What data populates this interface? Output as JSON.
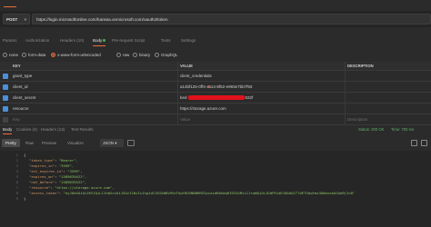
{
  "request": {
    "method": "POST",
    "url": "https://login.microsoftonline.com/hanssa.onmicrosoft.com/oauth2/token"
  },
  "request_tabs": [
    {
      "label": "Params"
    },
    {
      "label": "Authorization"
    },
    {
      "label": "Headers (10)"
    },
    {
      "label": "Body"
    },
    {
      "label": "Pre-request Script"
    },
    {
      "label": "Tests"
    },
    {
      "label": "Settings"
    }
  ],
  "body_types": [
    {
      "label": "none",
      "selected": false
    },
    {
      "label": "form-data",
      "selected": false
    },
    {
      "label": "x-www-form-urlencoded",
      "selected": true
    },
    {
      "label": "raw",
      "selected": false
    },
    {
      "label": "binary",
      "selected": false
    },
    {
      "label": "GraphQL",
      "selected": false
    }
  ],
  "params_table": {
    "headers": [
      "KEY",
      "VALUE",
      "DESCRIPTION"
    ],
    "rows": [
      {
        "key": "grant_type",
        "value": "client_credentials",
        "checked": true
      },
      {
        "key": "client_id",
        "value": "a14bf125-0ff4-4114-8f52-e993e7bb7f93",
        "checked": true
      },
      {
        "key": "client_secret",
        "value_prefix": "bed",
        "value_suffix": "832f",
        "checked": true
      },
      {
        "key": "resource",
        "value": "https://storage.azure.com",
        "checked": true
      },
      {
        "key": "Key",
        "value": "Value",
        "description": "Description",
        "checked": false
      }
    ]
  },
  "response_tabs": [
    {
      "label": "Body"
    },
    {
      "label": "Cookies (4)"
    },
    {
      "label": "Headers (13)"
    },
    {
      "label": "Test Results"
    }
  ],
  "response_status": {
    "code": "Status: 200 OK",
    "time": "Time: 700 ms"
  },
  "response_views": [
    {
      "label": "Pretty"
    },
    {
      "label": "Raw"
    },
    {
      "label": "Preview"
    },
    {
      "label": "Visualize"
    }
  ],
  "response_format": "JSON",
  "response_lines": [
    {
      "n": "1",
      "text": "{"
    },
    {
      "n": "2",
      "key": "\"token_type\"",
      "val": "\"Bearer\","
    },
    {
      "n": "3",
      "key": "\"expires_in\"",
      "val": "\"3599\","
    },
    {
      "n": "4",
      "key": "\"ext_expires_in\"",
      "val": "\"3599\","
    },
    {
      "n": "5",
      "key": "\"expires_on\"",
      "val": "\"1589639422\","
    },
    {
      "n": "6",
      "key": "\"not_before\"",
      "val": "\"1589635522\","
    },
    {
      "n": "7",
      "key": "\"resource\"",
      "val": "\"https://storage.azure.com\","
    },
    {
      "n": "8",
      "key": "\"access_token\"",
      "val": "\"eyJ0eXAiOiJKV1QiLCJhbGciOiJSUzI1NiIsIng1dCI6IkN0VHVoTUptRDVNN0RMZ2piazdRbGdqR3ZCb2MiLCJraWQiOiJDdFR1aE1KbUQ1TTdETGdqYms3UWxnakd2Qm9jIn0\""
    },
    {
      "n": "9",
      "text": "}"
    }
  ],
  "colors": {
    "accent": "#f26b3a",
    "redaction": "#e2111a",
    "checkbox": "#4a90d9"
  }
}
